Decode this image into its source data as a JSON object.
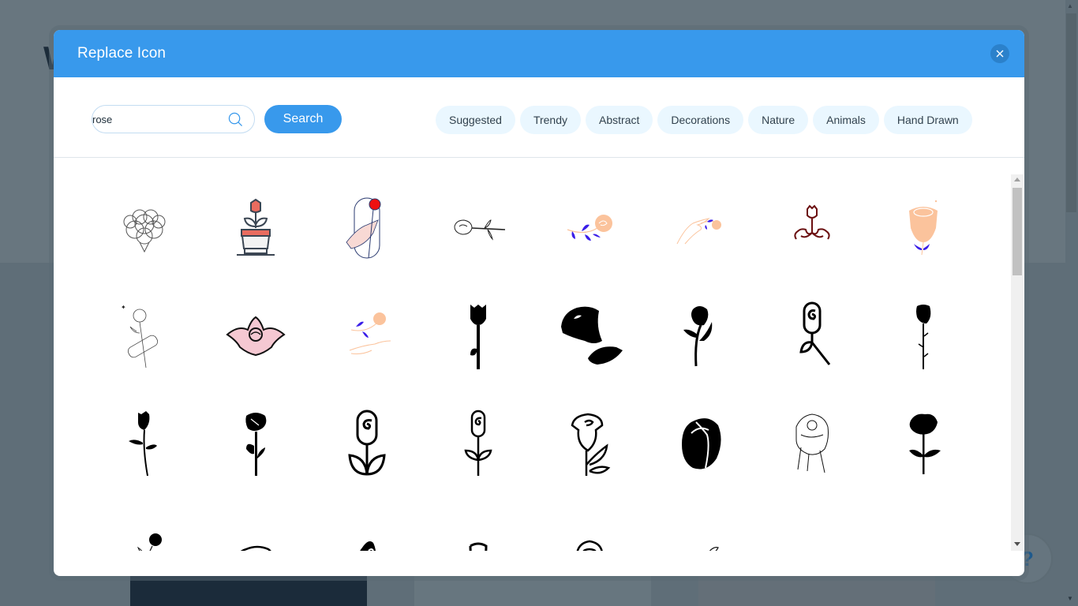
{
  "background": {
    "partial_heading_letter": "W",
    "help_label": "?"
  },
  "modal": {
    "title": "Replace Icon",
    "close_label": "close",
    "search": {
      "value": "rose",
      "placeholder": "",
      "button_label": "Search"
    },
    "categories": [
      {
        "label": "Suggested"
      },
      {
        "label": "Trendy"
      },
      {
        "label": "Abstract"
      },
      {
        "label": "Decorations"
      },
      {
        "label": "Nature"
      },
      {
        "label": "Animals"
      },
      {
        "label": "Hand Drawn"
      }
    ],
    "results": [
      {
        "icon": "rose-bouquet-outline-icon"
      },
      {
        "icon": "potted-rose-icon"
      },
      {
        "icon": "hand-holding-rose-icon"
      },
      {
        "icon": "rose-sketch-horizontal-icon"
      },
      {
        "icon": "peach-rose-branch-icon"
      },
      {
        "icon": "hand-with-peach-rose-icon"
      },
      {
        "icon": "rose-ornament-icon"
      },
      {
        "icon": "peach-rose-large-icon"
      },
      {
        "icon": "rose-with-bandage-icon"
      },
      {
        "icon": "pink-rose-tattoo-icon"
      },
      {
        "icon": "hand-catching-rose-icon"
      },
      {
        "icon": "tulip-silhouette-icon"
      },
      {
        "icon": "rose-large-silhouette-icon"
      },
      {
        "icon": "rose-stem-silhouette-icon"
      },
      {
        "icon": "spiral-rose-line-icon"
      },
      {
        "icon": "rosebud-thorn-icon"
      },
      {
        "icon": "long-stem-rose-icon"
      },
      {
        "icon": "rose-leaves-silhouette-icon"
      },
      {
        "icon": "spiral-rose-leaves-icon"
      },
      {
        "icon": "spiral-rose-thin-icon"
      },
      {
        "icon": "rose-outline-leaves-icon"
      },
      {
        "icon": "rosebud-filled-icon"
      },
      {
        "icon": "rose-sketch-detailed-icon"
      },
      {
        "icon": "rose-flower-silhouette-icon"
      },
      {
        "icon": "rose-small-stem-icon"
      },
      {
        "icon": "rose-swirl-head-icon"
      },
      {
        "icon": "rose-bud-black-icon"
      },
      {
        "icon": "spiral-bud-icon"
      },
      {
        "icon": "rose-cone-outline-icon"
      },
      {
        "icon": "rose-petals-sketch-icon"
      },
      {
        "icon": "rose-blob-black-icon"
      },
      {
        "icon": "rose-spiral-outline-icon"
      }
    ]
  },
  "colors": {
    "accent": "#3899ec",
    "chip_bg": "#eaf7ff",
    "overlay": "#66757f"
  }
}
